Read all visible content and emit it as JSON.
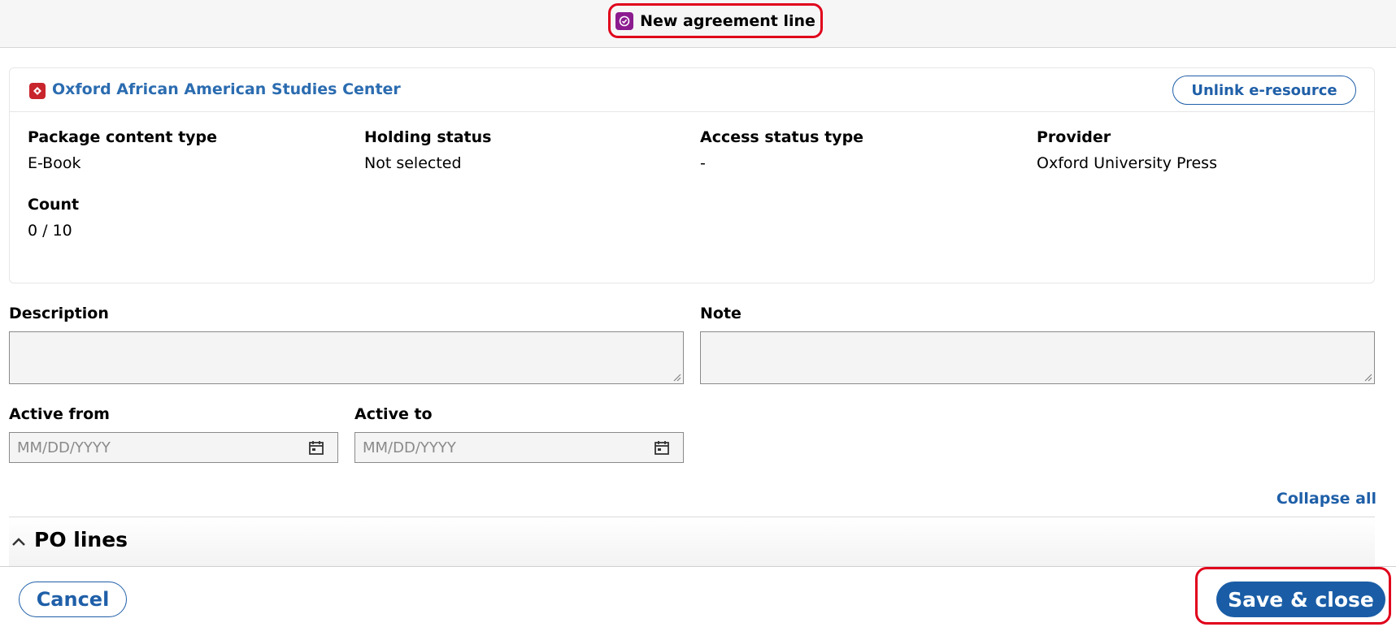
{
  "header": {
    "title": "New agreement line",
    "icon": "agreements-app-icon"
  },
  "eresource": {
    "name": "Oxford African American Studies Center",
    "unlink_label": "Unlink e-resource",
    "fields": [
      {
        "label": "Package content type",
        "value": "E-Book"
      },
      {
        "label": "Holding status",
        "value": "Not selected"
      },
      {
        "label": "Access status type",
        "value": "-"
      },
      {
        "label": "Provider",
        "value": "Oxford University Press"
      },
      {
        "label": "Count",
        "value": "0 / 10"
      }
    ]
  },
  "form": {
    "description_label": "Description",
    "description_value": "",
    "note_label": "Note",
    "note_value": "",
    "active_from_label": "Active from",
    "active_from_placeholder": "MM/DD/YYYY",
    "active_to_label": "Active to",
    "active_to_placeholder": "MM/DD/YYYY"
  },
  "sections": {
    "collapse_all_label": "Collapse all",
    "po_lines_title": "PO lines"
  },
  "footer": {
    "cancel_label": "Cancel",
    "save_label": "Save & close"
  },
  "colors": {
    "accent": "#1f5fa8",
    "highlight": "#e0001b",
    "app_icon": "#8b1b8f",
    "eresource_icon": "#c9252c"
  }
}
